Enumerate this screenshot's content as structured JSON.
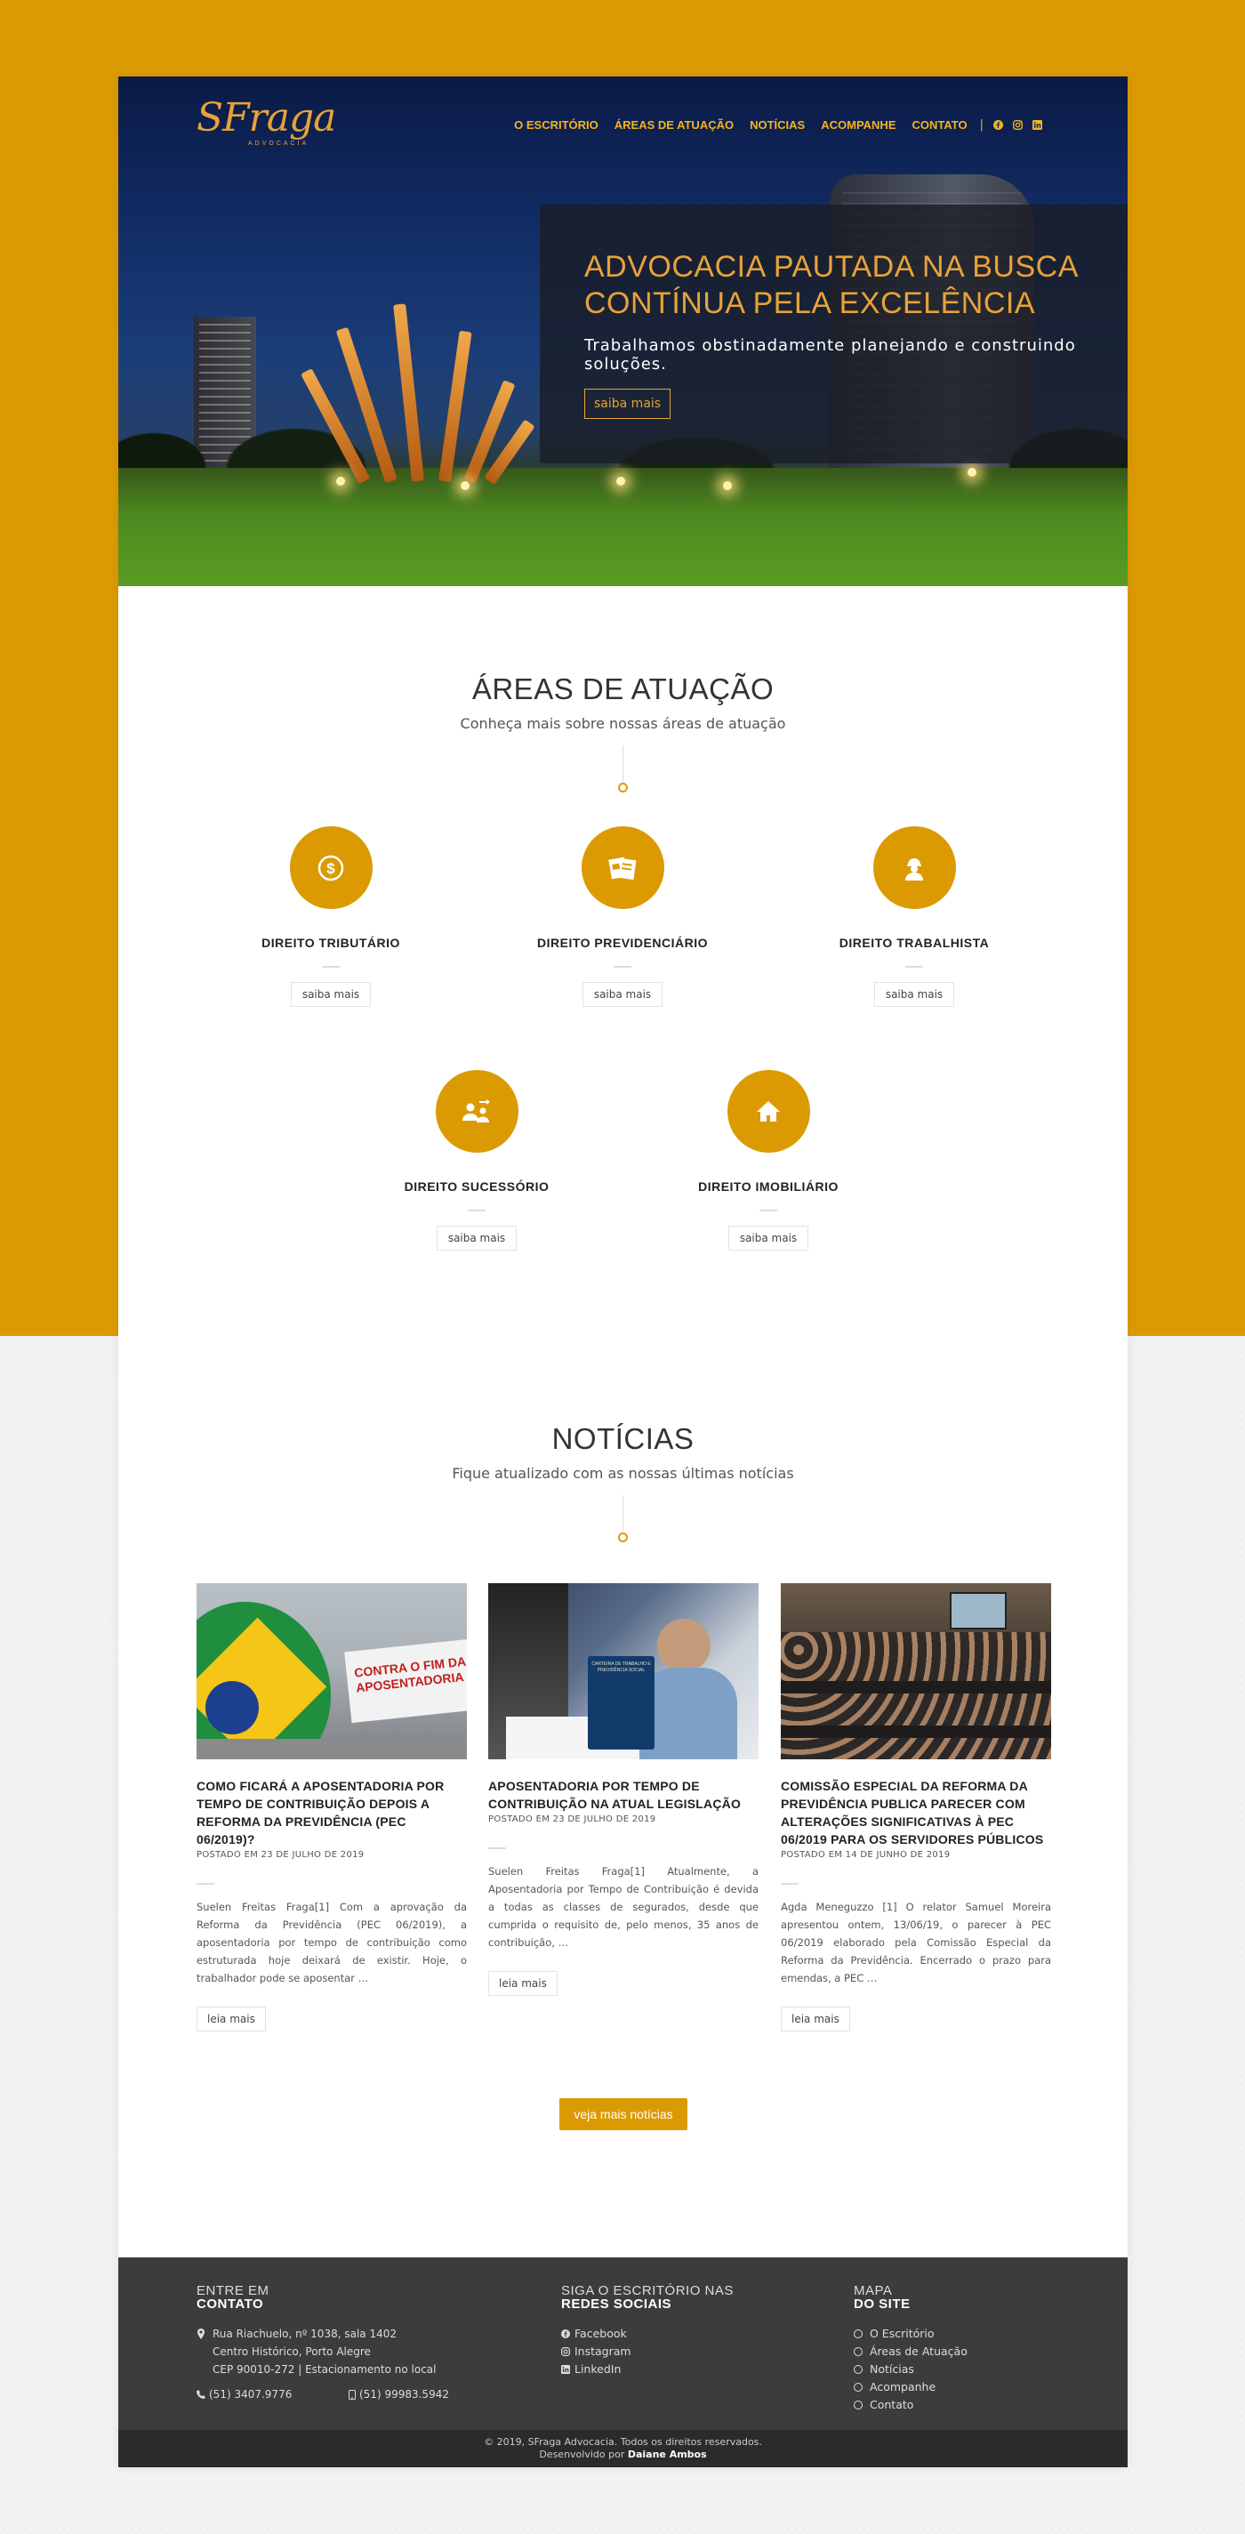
{
  "brand": {
    "logo_text": "SFraga",
    "logo_sub": "ADVOCACIA",
    "accent": "#dc9a02",
    "dark": "#3d3c3c"
  },
  "nav": {
    "items": [
      "O ESCRITÓRIO",
      "ÁREAS DE ATUAÇÃO",
      "NOTÍCIAS",
      "ACOMPANHE",
      "CONTATO"
    ],
    "separator": "|",
    "social_icons": [
      "facebook-icon",
      "instagram-icon",
      "linkedin-icon"
    ]
  },
  "hero": {
    "headline": "ADVOCACIA PAUTADA NA BUSCA CONTÍNUA PELA EXCELÊNCIA",
    "subtitle": "Trabalhamos obstinadamente planejando e construindo soluções.",
    "button": "saiba mais"
  },
  "areas": {
    "title": "ÁREAS DE ATUAÇÃO",
    "subtitle": "Conheça mais sobre nossas áreas de atuação",
    "items": [
      {
        "name": "DIREITO TRIBUTÁRIO",
        "icon": "dollar-coin-icon",
        "button": "saiba mais"
      },
      {
        "name": "DIREITO PREVIDENCIÁRIO",
        "icon": "documents-icon",
        "button": "saiba mais"
      },
      {
        "name": "DIREITO TRABALHISTA",
        "icon": "worker-icon",
        "button": "saiba mais"
      },
      {
        "name": "DIREITO SUCESSÓRIO",
        "icon": "family-icon",
        "button": "saiba mais"
      },
      {
        "name": "DIREITO IMOBILIÁRIO",
        "icon": "house-icon",
        "button": "saiba mais"
      }
    ]
  },
  "news": {
    "title": "NOTÍCIAS",
    "subtitle": "Fique atualizado com as nossas últimas notícias",
    "items": [
      {
        "title": "COMO FICARÁ A APOSENTADORIA POR TEMPO DE CONTRIBUIÇÃO DEPOIS A REFORMA DA PREVIDÊNCIA (PEC 06/2019)?",
        "date": "POSTADO EM 23 DE JULHO DE 2019",
        "excerpt": "Suelen Freitas Fraga[1] Com a aprovação da Reforma da Previdência (PEC 06/2019), a aposentadoria por tempo de contribuição como estruturada hoje deixará de existir. Hoje, o trabalhador pode se aposentar …",
        "button": "leia mais",
        "image_text": "CONTRA O FIM DA APOSENTADORIA"
      },
      {
        "title": "APOSENTADORIA POR TEMPO DE CONTRIBUIÇÃO NA ATUAL LEGISLAÇÃO",
        "date": "POSTADO EM 23 DE JULHO DE 2019",
        "excerpt": "Suelen Freitas Fraga[1] Atualmente, a Aposentadoria por Tempo de Contribuição é devida a todas as classes de segurados, desde que cumprida o requisito de, pelo menos, 35 anos de contribuição, …",
        "button": "leia mais",
        "image_text": "CARTEIRA DE TRABALHO E PREVIDÊNCIA SOCIAL"
      },
      {
        "title": "COMISSÃO ESPECIAL DA REFORMA DA PREVIDÊNCIA PUBLICA PARECER COM ALTERAÇÕES SIGNIFICATIVAS À PEC 06/2019 PARA OS SERVIDORES PÚBLICOS",
        "date": "POSTADO EM 14 DE JUNHO DE 2019",
        "excerpt": "Agda Meneguzzo [1] O relator Samuel Moreira apresentou ontem, 13/06/19, o parecer à PEC 06/2019 elaborado pela Comissão Especial da Reforma da Previdência. Encerrado o prazo para emendas, a PEC …",
        "button": "leia mais",
        "image_text": ""
      }
    ],
    "all_button": "veja mais notícias"
  },
  "footer": {
    "contact": {
      "heading_1": "ENTRE EM",
      "heading_2": "CONTATO",
      "address_1": "Rua Riachuelo, nº 1038, sala 1402",
      "address_2": "Centro Histórico, Porto Alegre",
      "address_3": "CEP 90010-272 | Estacionamento no local",
      "phone": "(51) 3407.9776",
      "mobile": "(51) 99983.5942"
    },
    "social": {
      "heading_1": "SIGA O ESCRITÓRIO NAS",
      "heading_2": "REDES SOCIAIS",
      "links": [
        "Facebook",
        "Instagram",
        "LinkedIn"
      ]
    },
    "sitemap": {
      "heading_1": "MAPA",
      "heading_2": "DO SITE",
      "links": [
        "O Escritório",
        "Áreas de Atuação",
        "Notícias",
        "Acompanhe",
        "Contato"
      ]
    },
    "copyright": "© 2019, SFraga Advocacia. Todos os direitos reservados.",
    "dev_prefix": "Desenvolvido por",
    "dev_name": "Daiane Ambos"
  }
}
